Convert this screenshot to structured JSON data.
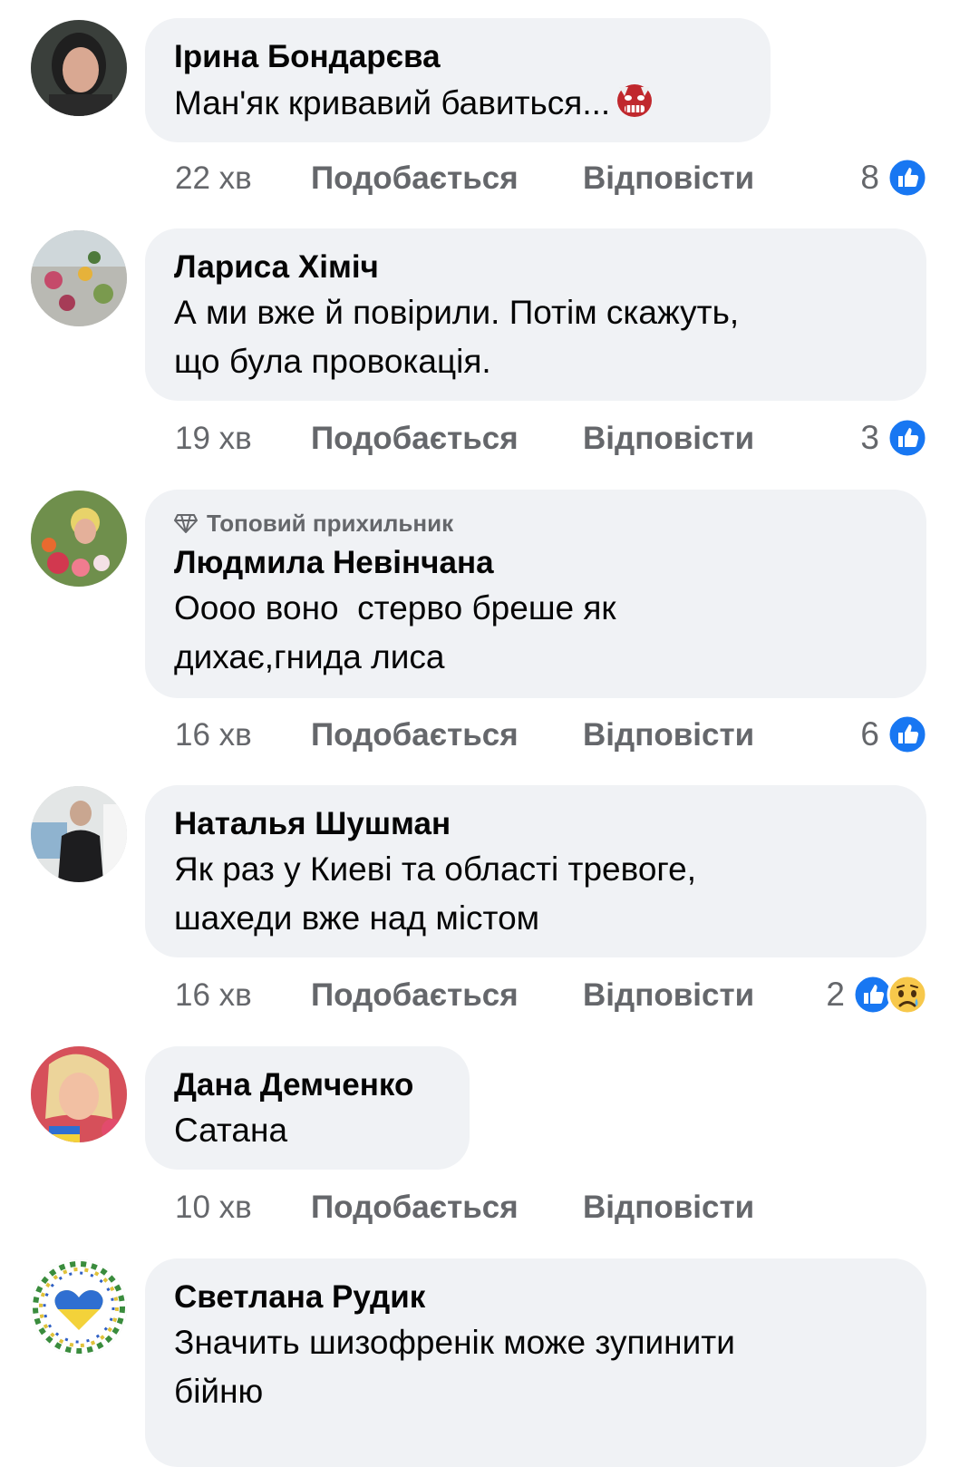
{
  "comments": [
    {
      "author": "Ірина Бондарєва",
      "text": "Ман'як кривавий бавиться...",
      "time": "22 хв",
      "like_label": "Подобається",
      "reply_label": "Відповісти",
      "reaction_count": "8",
      "reactions": [
        "like-icon"
      ],
      "inline_emoji": "ogre-emoji"
    },
    {
      "author": "Лариса Хіміч",
      "text": "А ми вже й повірили. Потім скажуть,\nщо була провокація.",
      "time": "19 хв",
      "like_label": "Подобається",
      "reply_label": "Відповісти",
      "reaction_count": "3",
      "reactions": [
        "like-icon"
      ]
    },
    {
      "badge": "Топовий прихильник",
      "author": "Людмила Невінчана",
      "text": "Оооо воно  стерво бреше як\nдихає,гнида лиса",
      "time": "16 хв",
      "like_label": "Подобається",
      "reply_label": "Відповісти",
      "reaction_count": "6",
      "reactions": [
        "like-icon"
      ]
    },
    {
      "author": "Наталья Шушман",
      "text": "Як раз у Киеві та області тревоге,\nшахеди вже над містом",
      "time": "16 хв",
      "like_label": "Подобається",
      "reply_label": "Відповісти",
      "reaction_count": "2",
      "reactions": [
        "like-icon",
        "sad-icon"
      ]
    },
    {
      "author": "Дана Демченко",
      "text": "Сатана",
      "time": "10 хв",
      "like_label": "Подобається",
      "reply_label": "Відповісти"
    },
    {
      "author": "Светлана Рудик",
      "text": "Значить шизофренік може зупинити\nбійню"
    }
  ],
  "colors": {
    "bubble": "#f0f2f5",
    "meta_text": "#65676b",
    "like_blue": "#1877f2"
  }
}
